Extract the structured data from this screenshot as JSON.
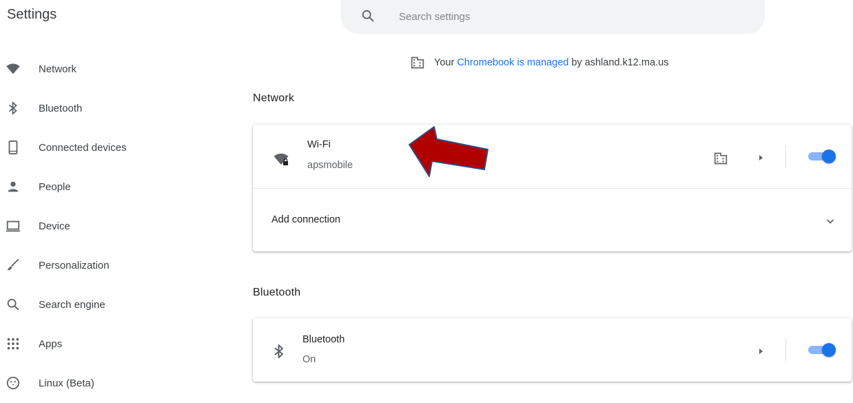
{
  "header": {
    "title": "Settings"
  },
  "search": {
    "placeholder": "Search settings",
    "value": ""
  },
  "sidebar": {
    "items": [
      {
        "label": "Network",
        "icon": "wifi-icon"
      },
      {
        "label": "Bluetooth",
        "icon": "bluetooth-icon"
      },
      {
        "label": "Connected devices",
        "icon": "phone-icon"
      },
      {
        "label": "People",
        "icon": "person-icon"
      },
      {
        "label": "Device",
        "icon": "laptop-icon"
      },
      {
        "label": "Personalization",
        "icon": "brush-icon"
      },
      {
        "label": "Search engine",
        "icon": "search-icon"
      },
      {
        "label": "Apps",
        "icon": "apps-grid-icon"
      },
      {
        "label": "Linux (Beta)",
        "icon": "penguin-icon"
      }
    ]
  },
  "managed": {
    "prefix": "Your",
    "link": "Chromebook is managed",
    "suffix": "by ashland.k12.ma.us",
    "icon": "building-icon"
  },
  "network": {
    "title": "Network",
    "wifi": {
      "name": "Wi-Fi",
      "ssid": "apsmobile",
      "enabled": true,
      "icon": "wifi-lock-icon"
    },
    "add_connection": {
      "label": "Add connection"
    }
  },
  "bluetooth": {
    "title": "Bluetooth",
    "name": "Bluetooth",
    "status": "On",
    "enabled": true,
    "icon": "bluetooth-icon"
  },
  "colors": {
    "accent": "#1a73e8",
    "toggle_track": "#8ab4f8",
    "callout_arrow": "#b00000",
    "callout_arrow_outline": "#2f4f8a"
  }
}
